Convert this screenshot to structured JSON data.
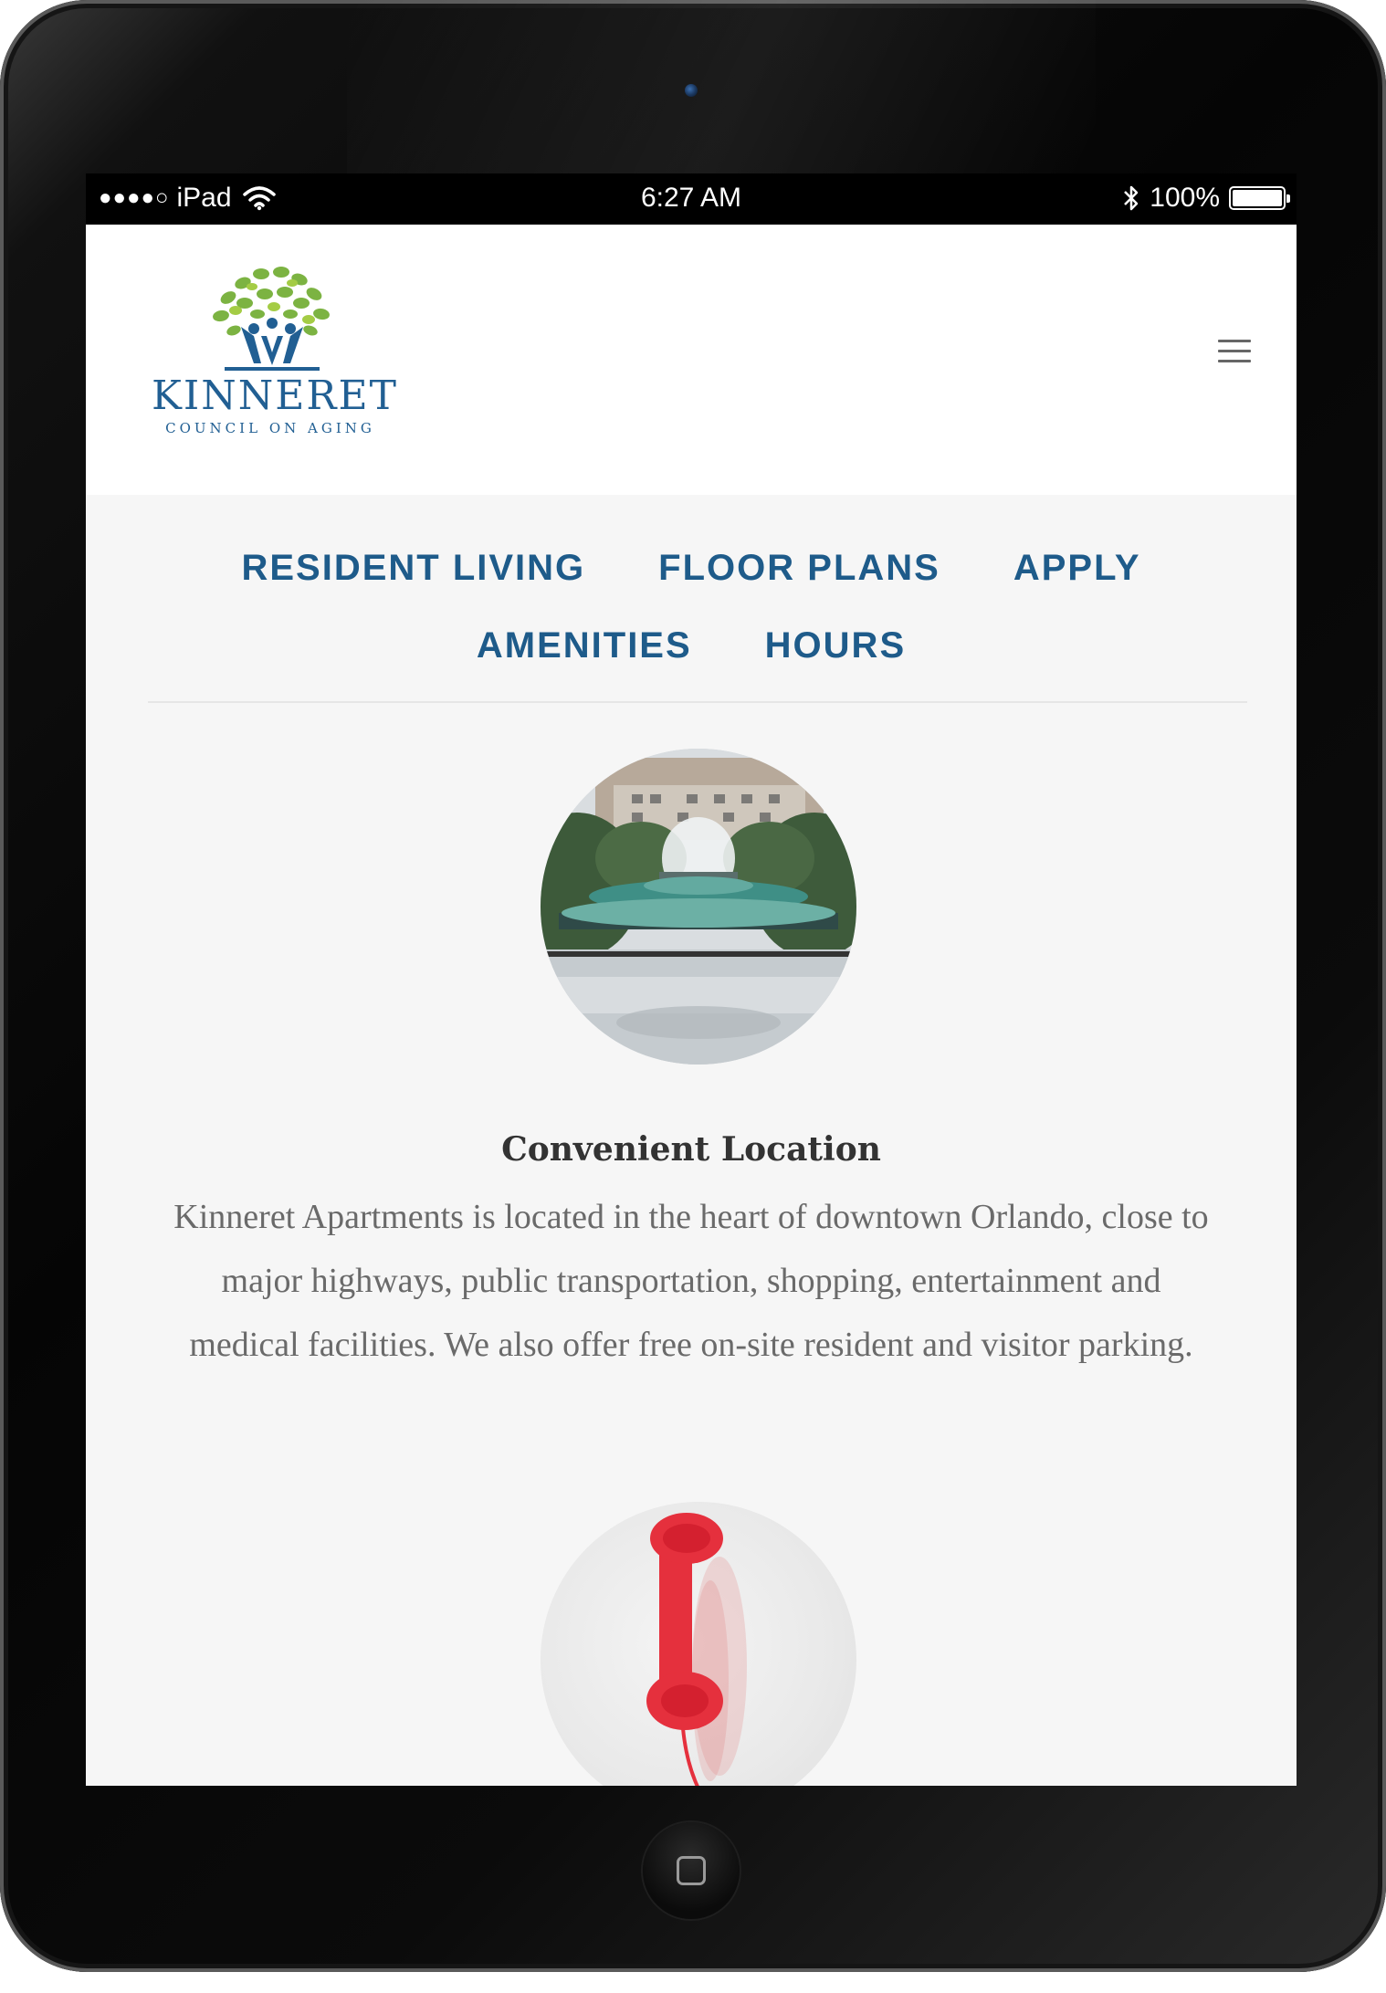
{
  "status_bar": {
    "signal": "●●●●○",
    "carrier": "iPad",
    "time": "6:27 AM",
    "battery": "100%"
  },
  "header": {
    "logo_name": "KINNERET",
    "logo_subtitle": "COUNCIL ON AGING",
    "menu_icon": "hamburger-icon"
  },
  "nav": {
    "row1": [
      "RESIDENT LIVING",
      "FLOOR PLANS",
      "APPLY"
    ],
    "row2": [
      "AMENITIES",
      "HOURS"
    ]
  },
  "feature": {
    "title": "Convenient Location",
    "text": "Kinneret Apartments is located in the heart of downtown Orlando, close to major highways, public transportation, shopping, entertainment and medical facilities.  We also offer free on-site resident and visitor parking."
  },
  "colors": {
    "nav_link": "#1e5b8a",
    "logo_blue": "#215f93",
    "logo_green": "#7cb342"
  }
}
